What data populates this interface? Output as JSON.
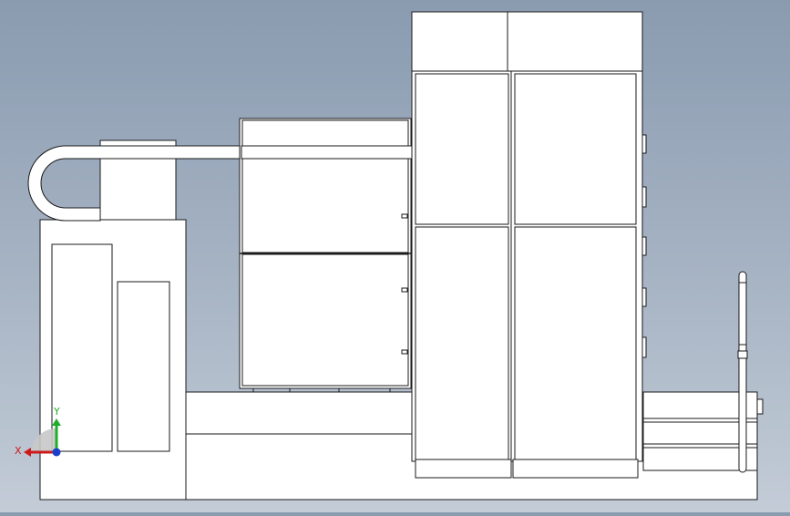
{
  "viewport": {
    "background_top": "#8a9bb0",
    "background_bottom": "#c3ccd7"
  },
  "model": {
    "fill": "#ffffff",
    "edge": "#1a1a1a",
    "components": [
      "base-frame",
      "left-electrical-cabinet",
      "cable-carrier-chain",
      "center-cabinet",
      "right-tower-cabinet",
      "side-linear-module",
      "vertical-rod"
    ]
  },
  "triad": {
    "x_label": "X",
    "y_label": "Y",
    "x_color": "#cc1a1a",
    "y_color": "#1fae2a",
    "z_color": "#1a3fcc"
  }
}
